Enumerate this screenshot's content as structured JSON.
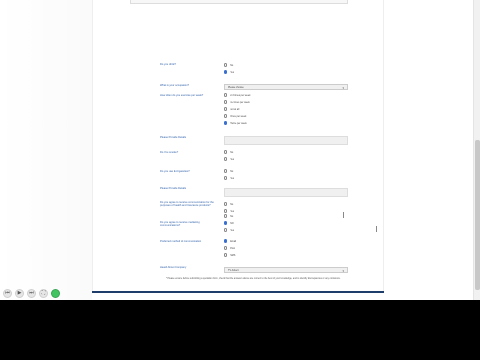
{
  "form": {
    "q1": {
      "label": "Do you drink?",
      "options": [
        "No",
        "Yes"
      ],
      "selected": 1
    },
    "q2": {
      "label": "What is your occupation?",
      "value": "Please choose"
    },
    "q3": {
      "label": "How often do you exercise per week?",
      "options": [
        "2-3 times per week",
        "4+ times per week",
        "not at all",
        "Once per week",
        "Twice per week"
      ],
      "selected": 4
    },
    "q4": {
      "label": "Please Provide Details",
      "value": ""
    },
    "q5": {
      "label": "Do You smoke?",
      "options": [
        "No",
        "Yes"
      ],
      "selected": null
    },
    "q6": {
      "label": "Do you use E-Cigarettes?",
      "options": [
        "No",
        "Yes"
      ],
      "selected": null
    },
    "q7": {
      "label": "Please Provide Details",
      "value": ""
    },
    "q8": {
      "label": "Do you agree to receive communication for the purposes of health and Insurance products?",
      "options": [
        "No",
        "Yes"
      ],
      "selected": null
    },
    "q9": {
      "label": "Do you agree to receive marketing communications?",
      "options": [
        "No",
        "NO",
        "Yes"
      ],
      "selected": 1
    },
    "q10": {
      "label": "Preferred method of communication",
      "options": [
        "Email",
        "Post",
        "SMS"
      ],
      "selected": 0
    },
    "q11": {
      "label": "Heard About Company",
      "value": "TV Advert"
    },
    "note": "* Please ensure before submitting a quotation form, check that the answers above are correct to the best of your knowledge, and to identify discrepancies or any omissions."
  },
  "controls": [
    "prev",
    "play",
    "next",
    "fullscreen",
    "go"
  ]
}
